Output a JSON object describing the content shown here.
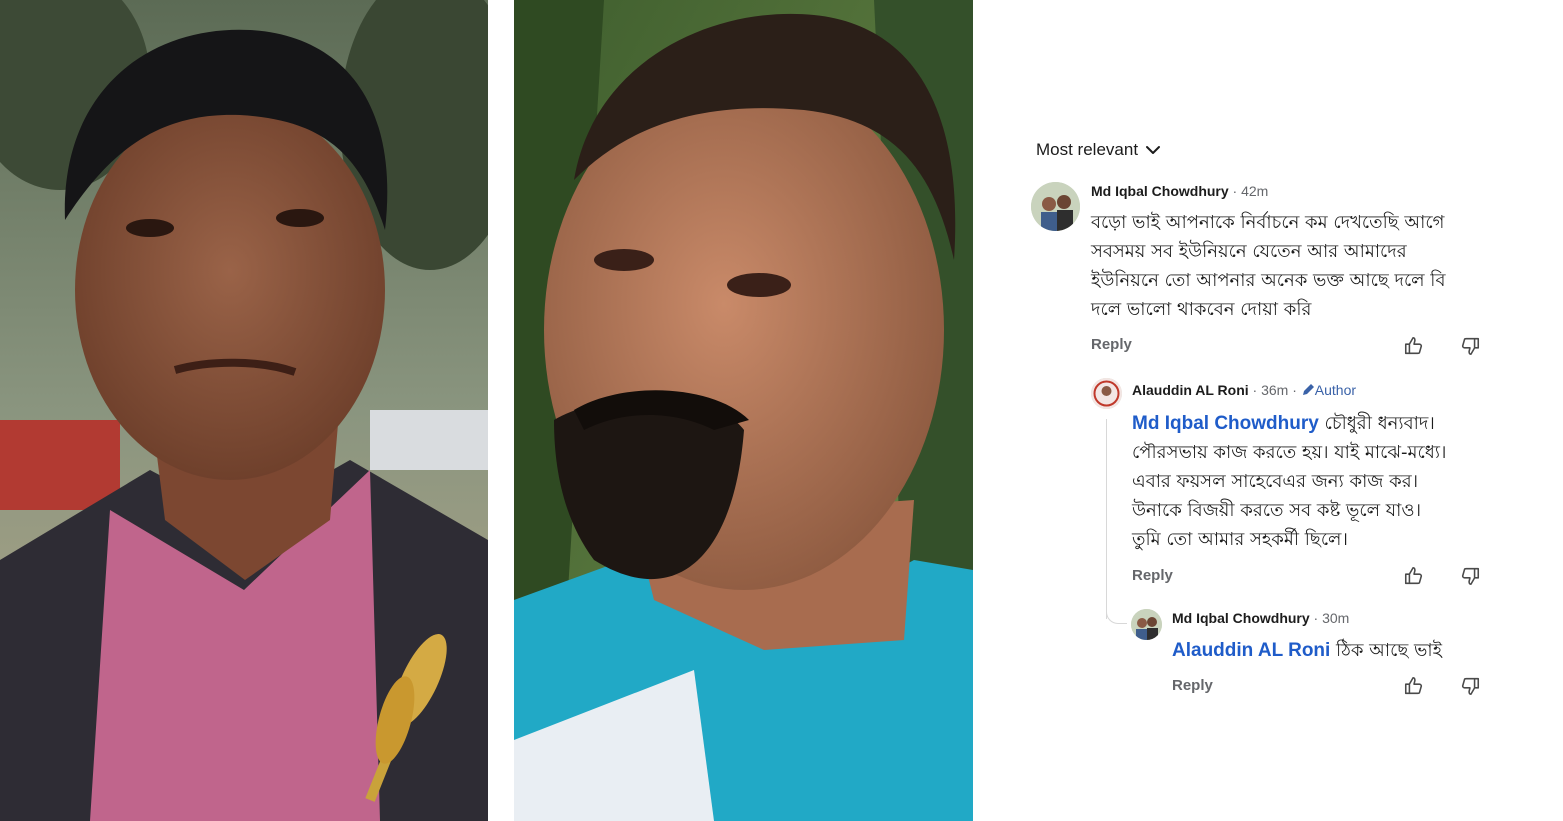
{
  "comments_panel": {
    "sort_label": "Most relevant",
    "comments": [
      {
        "author": "Md Iqbal Chowdhury",
        "time": "· 42m",
        "lines": [
          "বড়ো ভাই আপনাকে নির্বাচনে কম দেখতেছি আগে",
          "সবসময় সব ইউনিয়নে যেতেন আর আমাদের",
          "ইউনিয়নে তো আপনার অনেক ভক্ত আছে  দলে বি",
          "দলে ভালো থাকবেন দোয়া করি"
        ],
        "reply_label": "Reply"
      },
      {
        "author": "Alauddin AL Roni",
        "time": "· 36m ·",
        "badge": "Author",
        "mention": "Md Iqbal Chowdhury",
        "first_line_rest": " চৌধুরী ধন্যবাদ।",
        "lines": [
          "পৌরসভায় কাজ করতে হয়। যাই মাঝে-মধ্যে।",
          "এবার ফয়সল সাহেবেএর জন্য কাজ কর।",
          "উনাকে বিজয়ী করতে সব কষ্ট ভূলে যাও।",
          "তুমি তো আমার সহকর্মী ছিলে।"
        ],
        "reply_label": "Reply"
      },
      {
        "author": "Md Iqbal Chowdhury",
        "time": "· 30m",
        "mention": "Alauddin AL Roni",
        "text_rest": " ঠিক আছে ভাই",
        "reply_label": "Reply"
      }
    ]
  },
  "icons": {
    "sort": "chevron-down-icon",
    "like": "thumbs-up-icon",
    "dislike": "thumbs-down-icon",
    "author_badge": "pencil-icon"
  },
  "colors": {
    "mention": "#1f5cc9",
    "author_badge": "#3a62a8",
    "meta": "#65676b"
  }
}
